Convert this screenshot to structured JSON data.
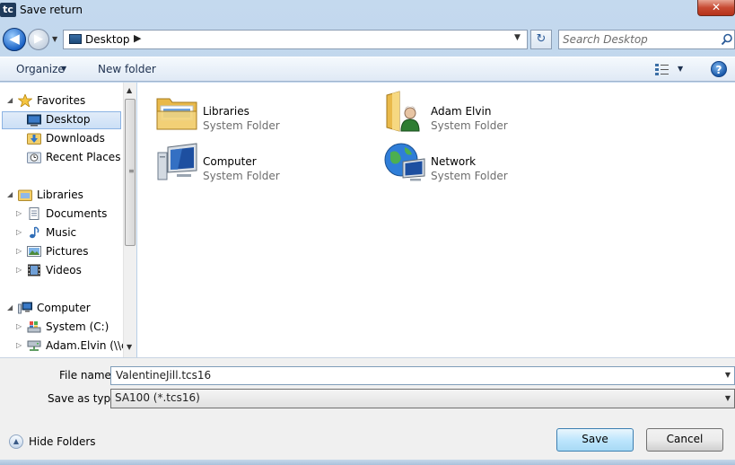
{
  "window": {
    "title": "Save return",
    "app_icon_text": "tc",
    "close_label": "✕"
  },
  "address": {
    "back_label": "◀",
    "forward_label": "▶",
    "location": "Desktop",
    "separator": "▶",
    "dropdown_arrow": "▼",
    "refresh_label": "↻"
  },
  "search": {
    "placeholder": "Search Desktop"
  },
  "toolbar": {
    "organize_label": "Organize",
    "organize_arrow": "▼",
    "new_folder_label": "New folder",
    "view_arrow": "▼",
    "help_label": "?"
  },
  "nav_tree": {
    "favorites_label": "Favorites",
    "desktop_label": "Desktop",
    "downloads_label": "Downloads",
    "recent_places_label": "Recent Places",
    "libraries_label": "Libraries",
    "documents_label": "Documents",
    "music_label": "Music",
    "pictures_label": "Pictures",
    "videos_label": "Videos",
    "computer_label": "Computer",
    "system_c_label": "System (C:)",
    "adam_elvin_label": "Adam.Elvin (\\\\c",
    "expanded_glyph": "◢",
    "collapsed_glyph": "▷"
  },
  "content": {
    "items": [
      {
        "name": "Libraries",
        "type": "System Folder"
      },
      {
        "name": "Adam Elvin",
        "type": "System Folder"
      },
      {
        "name": "Computer",
        "type": "System Folder"
      },
      {
        "name": "Network",
        "type": "System Folder"
      }
    ]
  },
  "form": {
    "file_name_label": "File name:",
    "file_name_value": "ValentineJill.tcs16",
    "save_as_type_label": "Save as type:",
    "save_as_type_value": "SA100 (*.tcs16)",
    "dropdown_arrow": "▼"
  },
  "footer": {
    "hide_folders_label": "Hide Folders",
    "hide_folders_glyph": "▲",
    "save_label": "Save",
    "cancel_label": "Cancel"
  },
  "colors": {
    "frame": "#b9d1ea",
    "selection": "#cbdff6",
    "save_button": "#bee6fd"
  }
}
